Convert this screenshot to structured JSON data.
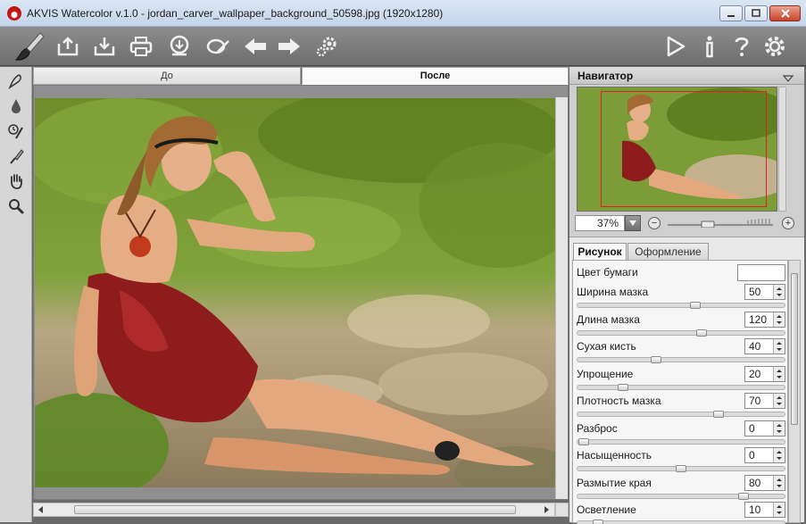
{
  "window": {
    "title": "AKVIS Watercolor v.1.0 - jordan_carver_wallpaper_background_50598.jpg (1920x1280)"
  },
  "toolbar": {
    "left_icons": [
      "brush-logo-icon",
      "open-icon",
      "save-icon",
      "print-icon",
      "share-icon",
      "batch-icon",
      "undo-icon",
      "redo-icon",
      "settings-small-icon"
    ],
    "right_icons": [
      "run-icon",
      "info-icon",
      "help-icon",
      "preferences-icon"
    ]
  },
  "tools": [
    "watercolor-brush-icon",
    "drop-icon",
    "history-brush-icon",
    "smudge-icon",
    "hand-icon",
    "zoom-icon"
  ],
  "canvas": {
    "tab_before": "До",
    "tab_after": "После"
  },
  "navigator": {
    "title": "Навигатор",
    "zoom": "37%"
  },
  "settings": {
    "tab_drawing": "Рисунок",
    "tab_decoration": "Оформление",
    "paper_color_label": "Цвет бумаги",
    "paper_color": "#ffffff",
    "params": [
      {
        "label": "Ширина мазка",
        "value": "50",
        "level": 0.57
      },
      {
        "label": "Длина мазка",
        "value": "120",
        "level": 0.6
      },
      {
        "label": "Сухая кисть",
        "value": "40",
        "level": 0.38
      },
      {
        "label": "Упрощение",
        "value": "20",
        "level": 0.22
      },
      {
        "label": "Плотность мазка",
        "value": "70",
        "level": 0.68
      },
      {
        "label": "Разброс",
        "value": "0",
        "level": 0.03
      },
      {
        "label": "Насыщенность",
        "value": "0",
        "level": 0.5
      },
      {
        "label": "Размытие края",
        "value": "80",
        "level": 0.8
      },
      {
        "label": "Осветление",
        "value": "10",
        "level": 0.1
      }
    ]
  }
}
